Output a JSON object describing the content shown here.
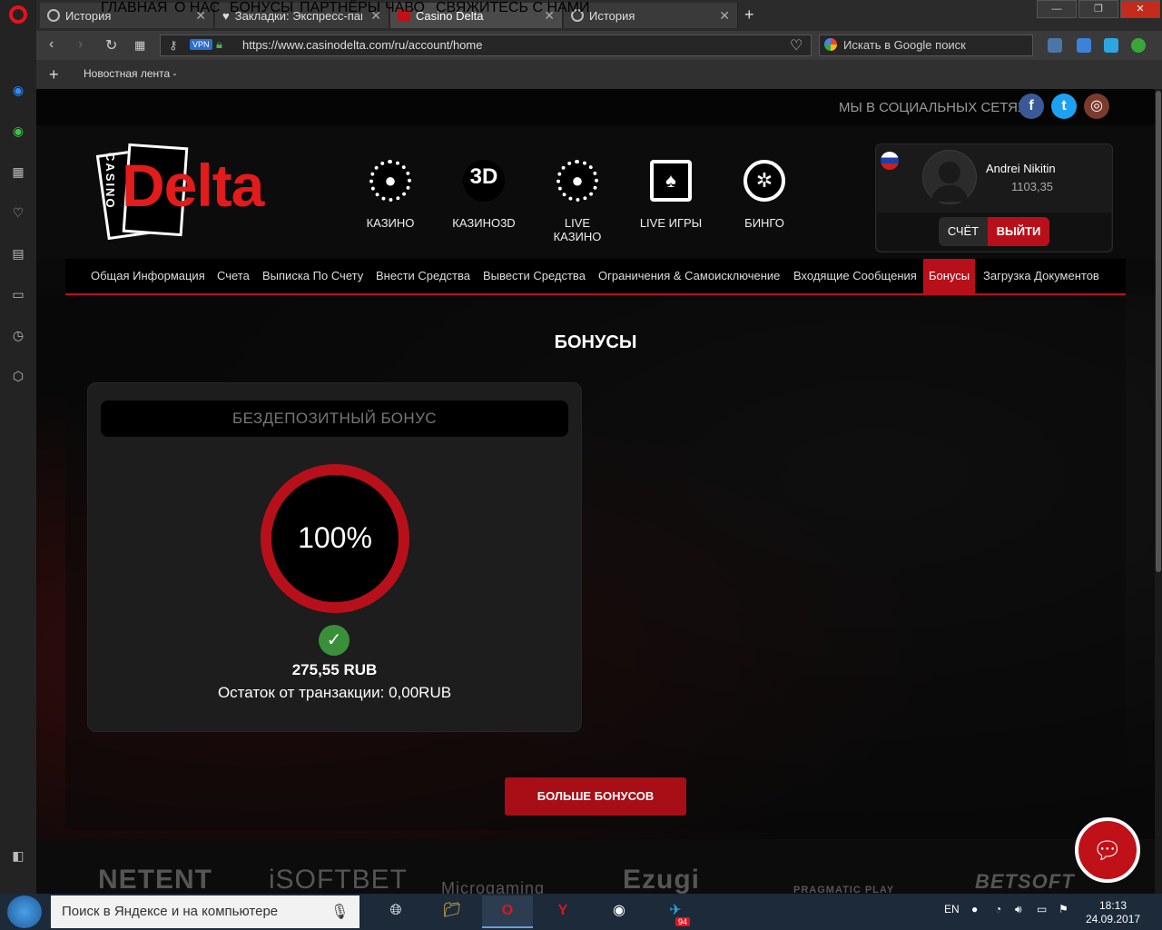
{
  "browser": {
    "tabs": [
      {
        "label": "История",
        "active": false
      },
      {
        "label": "Закладки: Экспресс-пане",
        "active": false
      },
      {
        "label": "Casino Delta",
        "active": true
      },
      {
        "label": "История",
        "active": false
      }
    ],
    "url": "https://www.casinodelta.com/ru/account/home",
    "search_placeholder": "Искать в Google поиск",
    "bookmark": "Новостная лента -",
    "new_tab": "+",
    "vpn": "VPN"
  },
  "site": {
    "nav": [
      "ГЛАВНАЯ",
      "О НАС",
      "БОНУСЫ",
      "ПАРТНЁРЫ",
      "ЧАВО",
      "СВЯЖИТЕСЬ С НАМИ"
    ],
    "social_label": "МЫ В СОЦИАЛЬНЫХ СЕТЯХ:",
    "social": {
      "facebook": "f",
      "twitter": "t",
      "instagram": "◎"
    },
    "logo": {
      "casino": "CASINO",
      "brand": "Delta"
    },
    "game_categories": [
      {
        "label": "КАЗИНО",
        "icon": "chip-icon",
        "glyph": "●"
      },
      {
        "label": "КАЗИНО3D",
        "icon": "3d-icon",
        "glyph": "3D"
      },
      {
        "label": "LIVE КАЗИНО",
        "icon": "chip-icon",
        "glyph": "●"
      },
      {
        "label": "LIVE ИГРЫ",
        "icon": "cards-icon",
        "glyph": "♠"
      },
      {
        "label": "БИНГО",
        "icon": "ferris-wheel-icon",
        "glyph": "✲"
      }
    ],
    "user": {
      "name": "Andrei Nikitin",
      "balance": "1103,35",
      "account_btn": "СЧЁТ",
      "logout_btn": "ВЫЙТИ"
    },
    "account_tabs": [
      {
        "label": "Общая Информация",
        "active": false
      },
      {
        "label": "Счета",
        "active": false
      },
      {
        "label": "Выписка По Счету",
        "active": false
      },
      {
        "label": "Внести Средства",
        "active": false
      },
      {
        "label": "Вывести Средства",
        "active": false
      },
      {
        "label": "Ограничения & Самоисключение",
        "active": false
      },
      {
        "label": "Входящие Сообщения",
        "active": false
      },
      {
        "label": "Бонусы",
        "active": true
      },
      {
        "label": "Загрузка Документов",
        "active": false
      }
    ],
    "page_title": "БОНУСЫ",
    "bonus": {
      "title": "БЕЗДЕПОЗИТНЫЙ БОНУС",
      "progress": "100%",
      "amount": "275,55 RUB",
      "remainder": "Остаток от транзакции: 0,00RUB"
    },
    "more_bonuses": "БОЛЬШЕ БОНУСОВ",
    "providers": [
      "NETENT",
      "iSOFTBET",
      "Microgaming",
      "Ezugi",
      "PRAGMATIC PLAY",
      "BETSOFT"
    ]
  },
  "taskbar": {
    "search": "Поиск в Яндексе и на компьютере",
    "lang": "EN",
    "time": "18:13",
    "date": "24.09.2017",
    "telegram_badge": "94"
  },
  "colors": {
    "accent": "#b8101a",
    "bg": "#0a0a0a",
    "success": "#3a8f3a"
  }
}
